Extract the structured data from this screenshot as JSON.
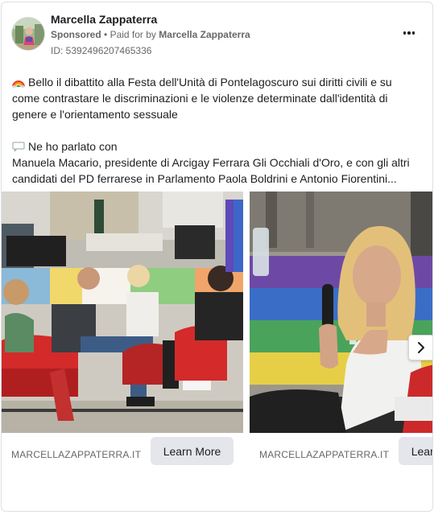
{
  "ad": {
    "advertiser": "Marcella Zappaterra",
    "sponsored_label": "Sponsored",
    "separator": "•",
    "paid_for_prefix": "Paid for by",
    "paid_for_name": "Marcella Zappaterra",
    "id_text": "ID: 5392496207465336",
    "more_icon": "more-horizontal-icon"
  },
  "body": {
    "line1_icon": "rainbow-emoji",
    "line1": "Bello il dibattito alla Festa dell'Unità di Pontelagoscuro sui diritti civili e su",
    "line2": "come contrastare le discriminazioni e le violenze determinate dall'identità di",
    "line3": "genere e l'orientamento sessuale",
    "line5_icon": "speech-bubble-emoji",
    "line5": "Ne ho parlato con",
    "line6": "Manuela Macario, presidente di Arcigay Ferrara Gli Occhiali d'Oro, e con gli altri",
    "line7": "candidati del PD ferrarese in Parlamento Paola Boldrini e Antonio Fiorentini..."
  },
  "carousel": {
    "cards": [
      {
        "caption": "MARCELLAZAPPATERRA.IT",
        "cta": "Learn More"
      },
      {
        "caption": "MARCELLAZAPPATERRA.IT",
        "cta": "Learn More"
      }
    ],
    "next_icon": "chevron-right-icon"
  },
  "colors": {
    "text_primary": "#1c1e21",
    "text_secondary": "#65676b",
    "button_bg": "#e4e6eb",
    "border": "#dcdfe3"
  }
}
